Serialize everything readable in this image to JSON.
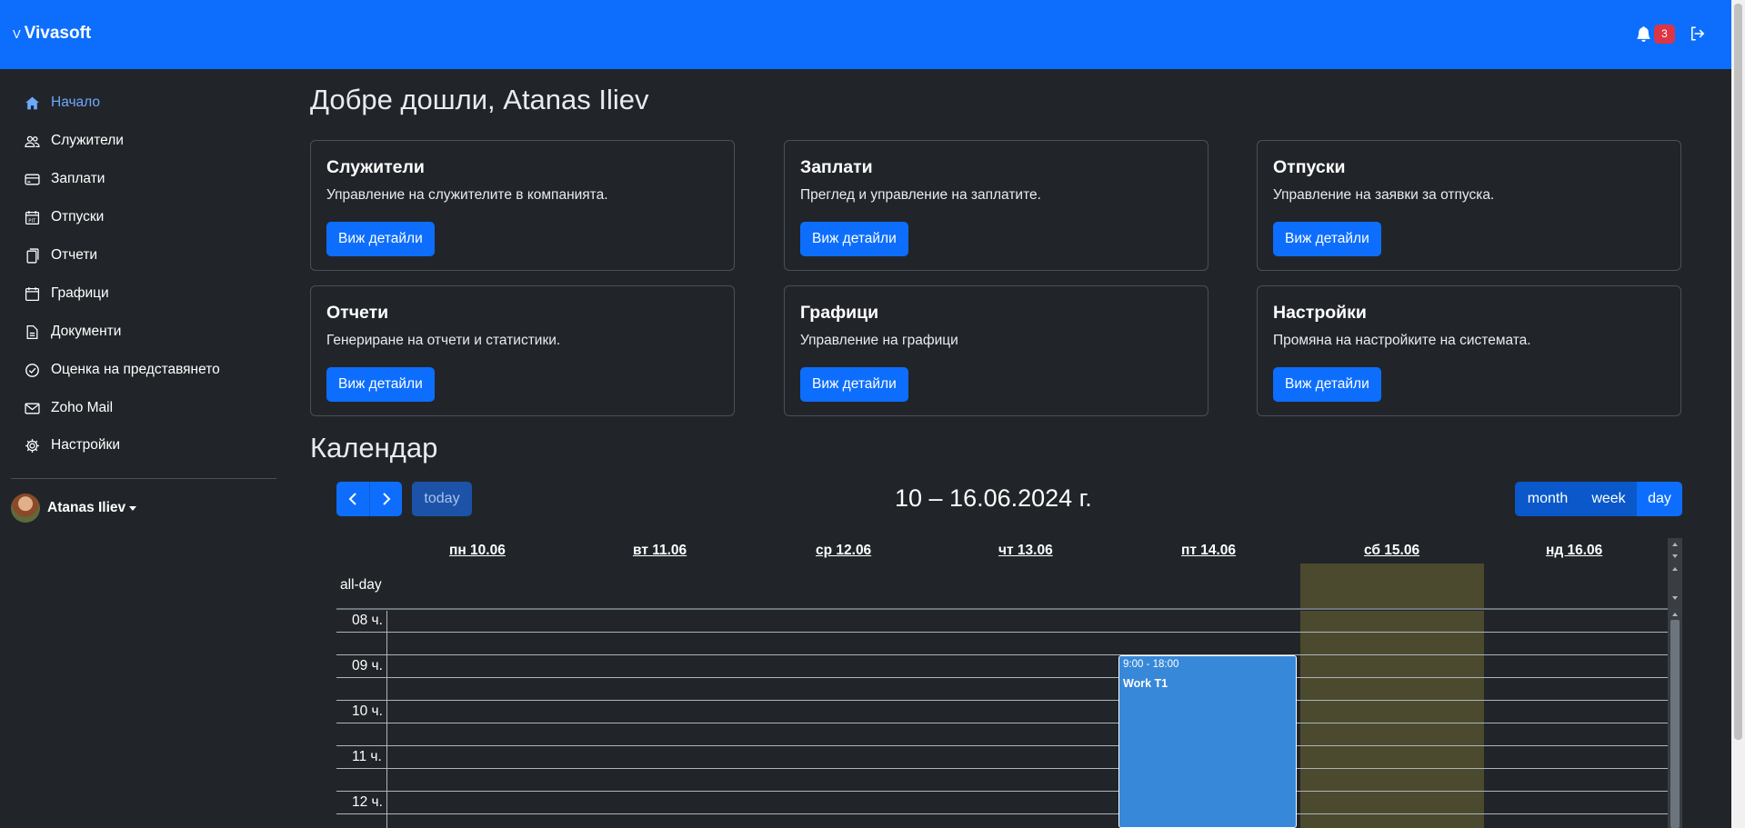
{
  "brand": {
    "prefix": "V",
    "name": "Vivasoft"
  },
  "header": {
    "notifications_count": "3"
  },
  "sidebar": {
    "items": [
      {
        "label": "Начало",
        "icon": "home-icon"
      },
      {
        "label": "Служители",
        "icon": "users-icon"
      },
      {
        "label": "Заплати",
        "icon": "credit-card-icon"
      },
      {
        "label": "Отпуски",
        "icon": "calendar-icon"
      },
      {
        "label": "Отчети",
        "icon": "files-icon"
      },
      {
        "label": "Графици",
        "icon": "calendar-blank-icon"
      },
      {
        "label": "Документи",
        "icon": "document-icon"
      },
      {
        "label": "Оценка на представянето",
        "icon": "check-circle-icon"
      },
      {
        "label": "Zoho Mail",
        "icon": "envelope-icon"
      },
      {
        "label": "Настройки",
        "icon": "gear-icon"
      }
    ],
    "user": "Atanas Iliev"
  },
  "main": {
    "welcome": "Добре дошли, Atanas Iliev",
    "cards": [
      {
        "title": "Служители",
        "desc": "Управление на служителите в компанията.",
        "button": "Виж детайли"
      },
      {
        "title": "Заплати",
        "desc": "Преглед и управление на заплатите.",
        "button": "Виж детайли"
      },
      {
        "title": "Отпуски",
        "desc": "Управление на заявки за отпуска.",
        "button": "Виж детайли"
      },
      {
        "title": "Отчети",
        "desc": "Генериране на отчети и статистики.",
        "button": "Виж детайли"
      },
      {
        "title": "Графици",
        "desc": "Управление на графици",
        "button": "Виж детайли"
      },
      {
        "title": "Настройки",
        "desc": "Промяна на настройките на системата.",
        "button": "Виж детайли"
      }
    ]
  },
  "calendar": {
    "title": "Календар",
    "range": "10 – 16.06.2024 г.",
    "today": "today",
    "views": [
      "month",
      "week",
      "day"
    ],
    "days": [
      "пн 10.06",
      "вт 11.06",
      "ср 12.06",
      "чт 13.06",
      "пт 14.06",
      "сб 15.06",
      "нд 16.06"
    ],
    "allday": "all-day",
    "hours": [
      "08 ч.",
      "09 ч.",
      "10 ч.",
      "11 ч.",
      "12 ч."
    ],
    "event": {
      "time": "9:00 - 18:00",
      "title": "Work T1",
      "color": "#3788d8"
    }
  },
  "colors": {
    "accent": "#0d6efd",
    "weekend": "#4b4a2e",
    "danger": "#dc3545"
  }
}
